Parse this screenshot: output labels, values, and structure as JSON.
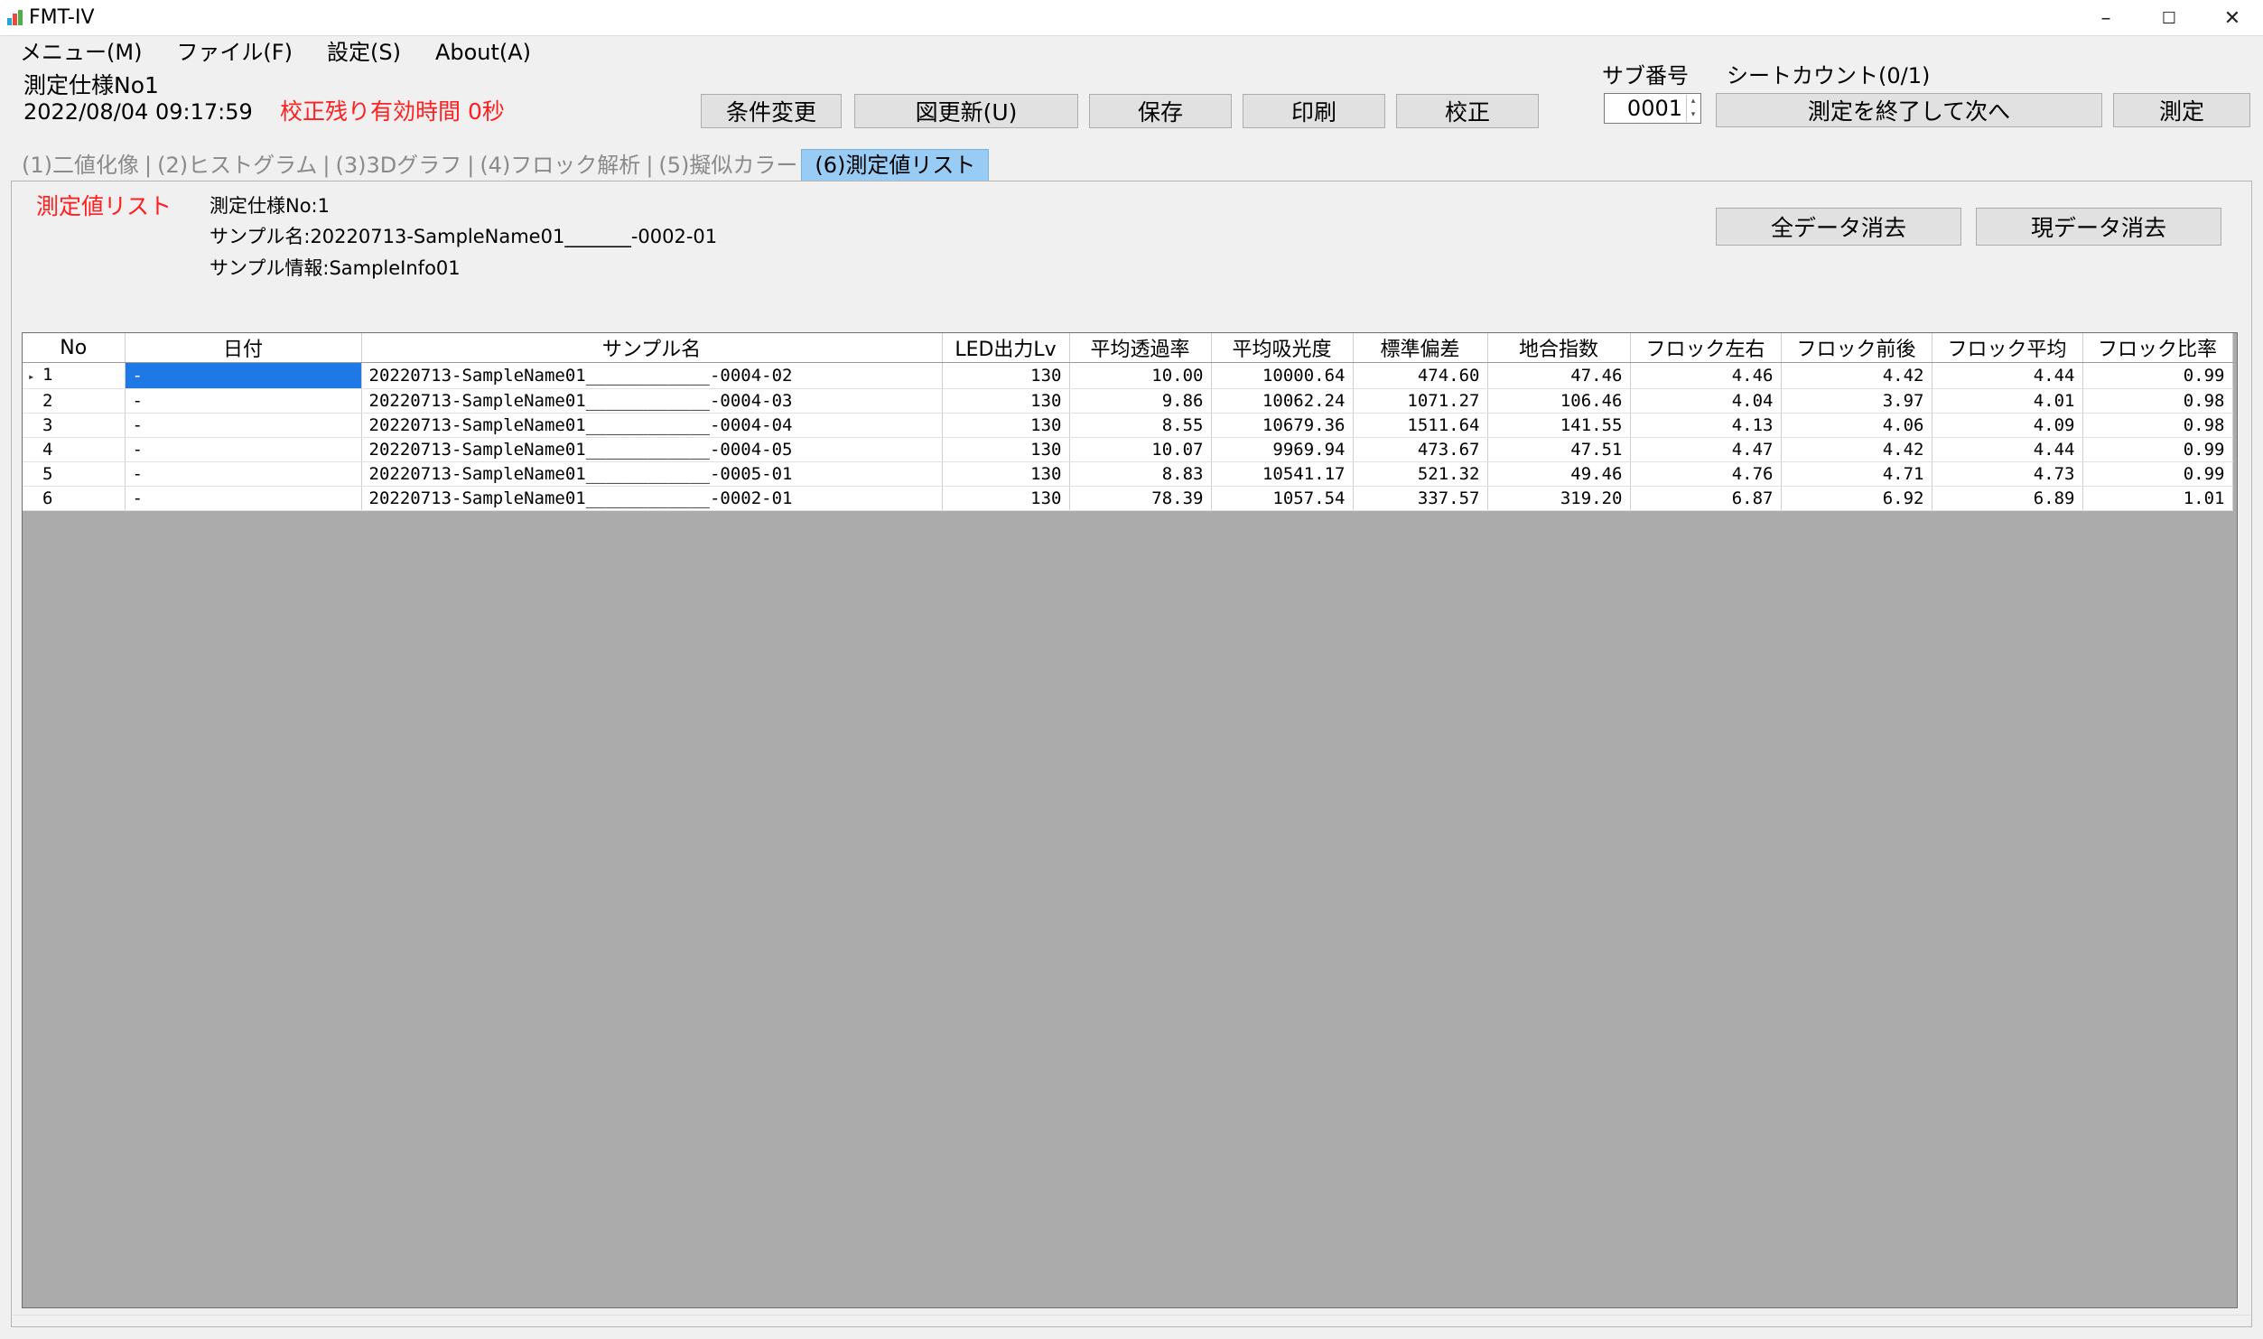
{
  "window": {
    "title": "FMT-IV",
    "minimize": "–",
    "maximize": "☐",
    "close": "✕"
  },
  "menu": [
    "メニュー(M)",
    "ファイル(F)",
    "設定(S)",
    "About(A)"
  ],
  "header": {
    "spec": "測定仕様No1",
    "datetime": "2022/08/04 09:17:59",
    "calibration_status": "校正残り有効時間 0秒"
  },
  "toolbar": {
    "change_conditions": "条件変更",
    "update_figure": "図更新(U)",
    "save": "保存",
    "print": "印刷",
    "calibrate": "校正",
    "finish_next": "測定を終了して次へ",
    "measure": "測定"
  },
  "sub": {
    "label": "サブ番号",
    "value": "0001",
    "sheet_count": "シートカウント(0/1)"
  },
  "tabs": [
    "(1)二値化像",
    "(2)ヒストグラム",
    "(3)3Dグラフ",
    "(4)フロック解析",
    "(5)擬似カラー",
    "(6)測定値リスト"
  ],
  "panel": {
    "title": "測定値リスト",
    "spec": "測定仕様No:1",
    "sample_name": "サンプル名:20220713-SampleName01_______-0002-01",
    "sample_info": "サンプル情報:SampleInfo01",
    "clear_all": "全データ消去",
    "clear_current": "現データ消去"
  },
  "table": {
    "columns": [
      "No",
      "日付",
      "サンプル名",
      "LED出力Lv",
      "平均透過率",
      "平均吸光度",
      "標準偏差",
      "地合指数",
      "フロック左右",
      "フロック前後",
      "フロック平均",
      "フロック比率"
    ],
    "rows": [
      [
        "1",
        "-",
        "20220713-SampleName01____________-0004-02",
        "130",
        "10.00",
        "10000.64",
        "474.60",
        "47.46",
        "4.46",
        "4.42",
        "4.44",
        "0.99"
      ],
      [
        "2",
        "-",
        "20220713-SampleName01____________-0004-03",
        "130",
        "9.86",
        "10062.24",
        "1071.27",
        "106.46",
        "4.04",
        "3.97",
        "4.01",
        "0.98"
      ],
      [
        "3",
        "-",
        "20220713-SampleName01____________-0004-04",
        "130",
        "8.55",
        "10679.36",
        "1511.64",
        "141.55",
        "4.13",
        "4.06",
        "4.09",
        "0.98"
      ],
      [
        "4",
        "-",
        "20220713-SampleName01____________-0004-05",
        "130",
        "10.07",
        "9969.94",
        "473.67",
        "47.51",
        "4.47",
        "4.42",
        "4.44",
        "0.99"
      ],
      [
        "5",
        "-",
        "20220713-SampleName01____________-0005-01",
        "130",
        "8.83",
        "10541.17",
        "521.32",
        "49.46",
        "4.76",
        "4.71",
        "4.73",
        "0.99"
      ],
      [
        "6",
        "-",
        "20220713-SampleName01____________-0002-01",
        "130",
        "78.39",
        "1057.54",
        "337.57",
        "319.20",
        "6.87",
        "6.92",
        "6.89",
        "1.01"
      ]
    ],
    "selected_row_marker": "▸"
  },
  "colors": {
    "accent_red": "#ff1f1f",
    "active_tab": "#99ccf5",
    "selection": "#1e78e6",
    "grid_empty": "#ababab"
  }
}
